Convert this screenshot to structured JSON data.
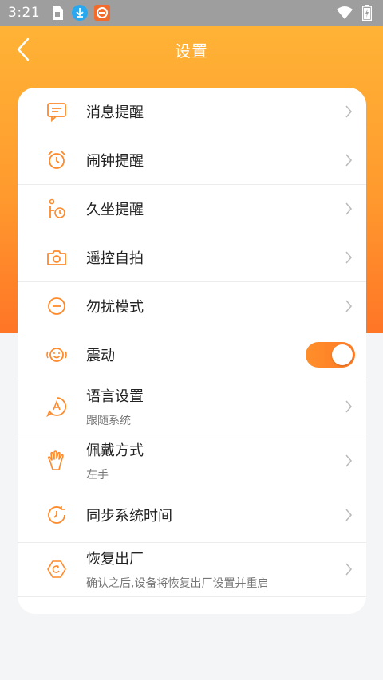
{
  "status_bar": {
    "time": "3:21",
    "icons": [
      "sim-card-icon",
      "download-icon",
      "app-notification-icon",
      "wifi-icon",
      "battery-icon"
    ]
  },
  "header": {
    "title": "设置",
    "back_icon": "chevron-left-icon"
  },
  "colors": {
    "accent": "#ff8a2a",
    "header_top": "#ffb336",
    "header_bottom": "#ff7526"
  },
  "settings": {
    "items": [
      {
        "label": "消息提醒",
        "icon": "message-icon"
      },
      {
        "label": "闹钟提醒",
        "icon": "alarm-clock-icon"
      },
      {
        "label": "久坐提醒",
        "icon": "sedentary-icon"
      },
      {
        "label": "遥控自拍",
        "icon": "camera-icon"
      },
      {
        "label": "勿扰模式",
        "icon": "do-not-disturb-icon"
      },
      {
        "label": "震动",
        "icon": "vibration-icon",
        "toggle_on": true
      },
      {
        "label": "语言设置",
        "sub": "跟随系统",
        "icon": "language-icon"
      },
      {
        "label": "佩戴方式",
        "sub": "左手",
        "icon": "hand-icon"
      },
      {
        "label": "同步系统时间",
        "icon": "sync-time-icon"
      },
      {
        "label": "恢复出厂",
        "sub": "确认之后,设备将恢复出厂设置并重启",
        "icon": "factory-reset-icon"
      }
    ]
  }
}
